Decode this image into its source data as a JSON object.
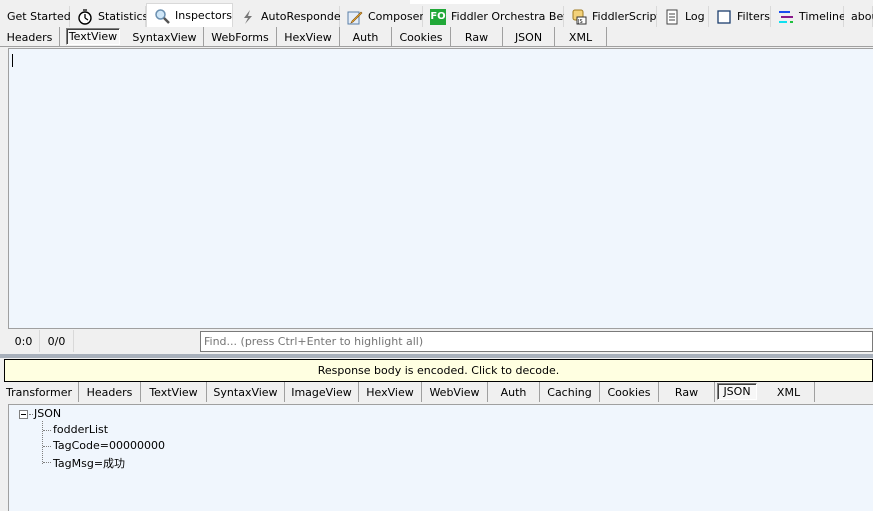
{
  "top_tabs": [
    {
      "label": "Get Started",
      "icon": ""
    },
    {
      "label": "Statistics",
      "icon": "stopwatch-icon"
    },
    {
      "label": "Inspectors",
      "icon": "magnifier-icon",
      "selected": true
    },
    {
      "label": "AutoResponder",
      "icon": "lightning-icon"
    },
    {
      "label": "Composer",
      "icon": "pencil-note-icon"
    },
    {
      "label": "Fiddler Orchestra Beta",
      "icon": "fo-icon",
      "icon_text": "FO"
    },
    {
      "label": "FiddlerScript",
      "icon": "script-scroll-icon"
    },
    {
      "label": "Log",
      "icon": "log-document-icon"
    },
    {
      "label": "Filters",
      "icon": "checkbox-icon"
    },
    {
      "label": "Timeline",
      "icon": "timeline-icon"
    },
    {
      "label": "abou",
      "icon": ""
    }
  ],
  "request_tabs": [
    "Headers",
    "TextView",
    "SyntaxView",
    "WebForms",
    "HexView",
    "Auth",
    "Cookies",
    "Raw",
    "JSON",
    "XML"
  ],
  "request_selected": "TextView",
  "request_text": "",
  "status": {
    "position": "0:0",
    "selection": "0/0"
  },
  "find": {
    "placeholder": "Find... (press Ctrl+Enter to highlight all)"
  },
  "notice": "Response body is encoded. Click to decode.",
  "response_tabs": [
    "Transformer",
    "Headers",
    "TextView",
    "SyntaxView",
    "ImageView",
    "HexView",
    "WebView",
    "Auth",
    "Caching",
    "Cookies",
    "Raw",
    "JSON",
    "XML"
  ],
  "response_selected": "JSON",
  "tree": {
    "root": "JSON",
    "children": [
      "fodderList",
      "TagCode=00000000",
      "TagMsg=成功"
    ]
  },
  "colors": {
    "pane_bg": "#f0f6fd",
    "notice_bg": "#ffffe1",
    "fo_green": "#21a838"
  }
}
